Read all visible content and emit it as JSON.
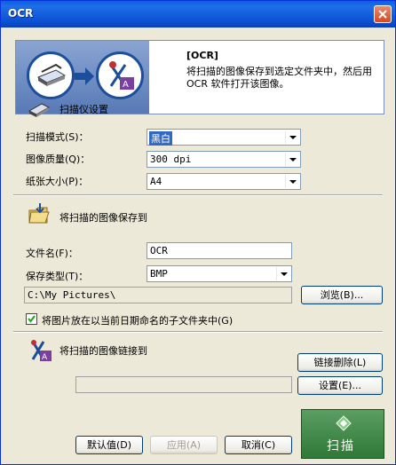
{
  "window": {
    "title": "OCR"
  },
  "banner": {
    "title": "[OCR]",
    "description": "将扫描的图像保存到选定文件夹中，然后用 OCR 软件打开该图像。"
  },
  "scanner_section": {
    "heading": "扫描仪设置",
    "scan_mode_label": "扫描模式(S)：",
    "scan_mode_value": "黑白",
    "quality_label": "图像质量(Q)：",
    "quality_value": "300 dpi",
    "paper_label": "纸张大小(P)：",
    "paper_value": "A4"
  },
  "save_section": {
    "heading": "将扫描的图像保存到",
    "filename_label": "文件名(F)：",
    "filename_value": "OCR",
    "type_label": "保存类型(T)：",
    "type_value": "BMP",
    "path_value": "C:\\My Pictures\\",
    "browse_label": "浏览(B)...",
    "subfolder_label": "将图片放在以当前日期命名的子文件夹中(G)",
    "subfolder_checked": true
  },
  "link_section": {
    "heading": "将扫描的图像链接到",
    "unlink_label": "链接删除(L)",
    "link_value": "",
    "settings_label": "设置(E)..."
  },
  "footer": {
    "default_label": "默认值(D)",
    "apply_label": "应用(A)",
    "cancel_label": "取消(C)",
    "scan_label": "扫描"
  },
  "colors": {
    "titlebar": "#0a4fd0",
    "selection": "#316ac5",
    "scan_button": "#2f7837"
  }
}
